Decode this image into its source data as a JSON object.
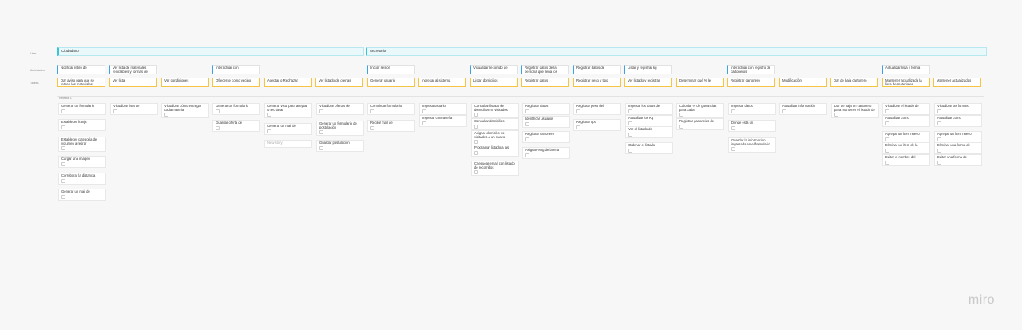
{
  "row_labels": [
    "User",
    "Actividades",
    "Tareas"
  ],
  "release_label": "Release 1",
  "brand": "miro",
  "lanes": [
    "Ciudadano",
    "Secretaria"
  ],
  "activities": [
    "Notificar retiro de",
    "Ver lista de materiales reciclables y formas de",
    "Interactuar con",
    "Iniciar sesión",
    "Visualizar recorrido de",
    "Registrar datos de la persona que llena los",
    "Registrar datos de",
    "Listar y registrar kg",
    "Interactuar con registro de cartoneros",
    "Actualizar lista y forma"
  ],
  "tasks_row": [
    "Dar aviso para que se retiren los materiales",
    "Ver lista",
    "Ver condiciones",
    "Ofrecerse como vecino",
    "Aceptar o Rechazar",
    "Ver listado de ofertas",
    "Generar usuario",
    "Ingresar al sistema",
    "Listar domicilios",
    "Registrar datos",
    "Registrar peso y tipo",
    "Ver listado y registrar",
    "Determinar qué % le",
    "Registrar cartonero",
    "Modificación",
    "Dar de baja cartonero",
    "Mantener actualizada la lista de materiales",
    "Mantener actualizadas"
  ],
  "stories": [
    [
      "Generar un formulario",
      "Establecer franja",
      "Establecer categoría del volumen a retirar",
      "Cargar una imagen",
      "Corroborar la distancia",
      "Generar un mail de"
    ],
    [
      "Visualizar lista de"
    ],
    [
      "Visualizar cómo entregar cada material"
    ],
    [
      "Generar un formulario",
      "Guardar oferta de"
    ],
    [
      "Generar vista para aceptar o rechazar",
      "Generar un mail de",
      "New story"
    ],
    [
      "Visualizar ofertas de",
      "Generar un formulario de postulación",
      "Guardar postulación"
    ],
    [
      "Completar formulario",
      "Recibir mail de"
    ],
    [
      "Ingresa usuario",
      "Ingresar contraseña"
    ],
    [
      "Consultar listado de domicilios no visitados",
      "Consultar domicilios",
      "Asignar domicilio no visitados a un nuevo",
      "Programar listado a las",
      "Chequear email con listado de recorridos"
    ],
    [
      "Registrar datos",
      "Identificar usuarios",
      "Registrar cartonero",
      "Asignar %kg de buena"
    ],
    [
      "Registrar peso del",
      "Registrar tipo"
    ],
    [
      "Ingresar los datos de",
      "Actualizar los Kg",
      "Ver el listado de",
      "Ordenar el listado"
    ],
    [
      "Calcular % de ganancias para cada",
      "Registrar ganancias de"
    ],
    [
      "Ingresar datos",
      "Dónde está un",
      "Guardar la información ingresada en el formulario"
    ],
    [
      "Actualizar información"
    ],
    [
      "Dar de baja un cartonero para mantener el listado de"
    ],
    [
      "Visualizar el listado de",
      "Actualizar como",
      "Agregar un ítem nuevo",
      "Eliminar un ítem de la",
      "Editar el nombre del"
    ],
    [
      "Visualizar las formas",
      "Actualizar como",
      "Agregar un ítem nuevo",
      "Eliminar una forma de",
      "Editar una forma de"
    ]
  ]
}
